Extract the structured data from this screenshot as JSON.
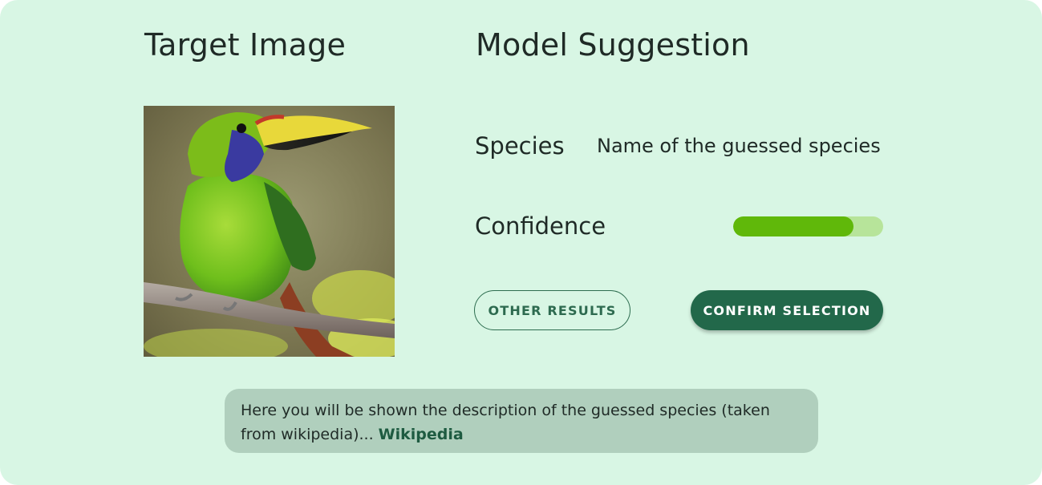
{
  "target": {
    "title": "Target Image"
  },
  "model": {
    "title": "Model Suggestion",
    "species_label": "Species",
    "species_value": "Name of the guessed species",
    "confidence_label": "Confidence",
    "confidence_fraction": 0.8
  },
  "buttons": {
    "other_results": "OTHER RESULTS",
    "confirm": "CONFIRM SELECTION"
  },
  "description": {
    "text": "Here you will be shown the description of the guessed species (taken from wikipedia)...",
    "link_label": "Wikipedia"
  },
  "colors": {
    "background": "#d8f6e4",
    "accent": "#22684a",
    "confidence_fill": "#60b80a",
    "confidence_track": "#b7e49a",
    "description_bg": "#b0cfbd"
  }
}
